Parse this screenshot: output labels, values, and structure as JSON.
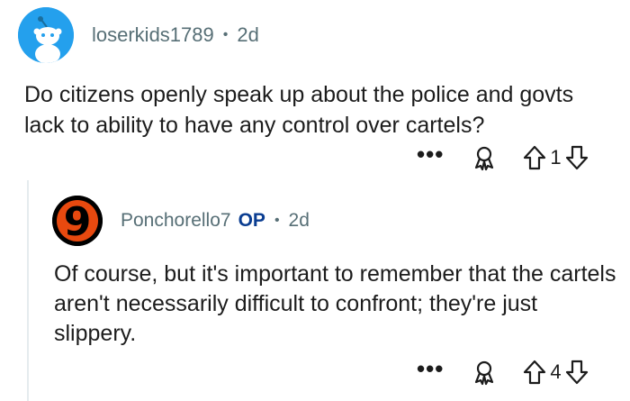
{
  "comment": {
    "author": "loserkids1789",
    "separator": "•",
    "age": "2d",
    "text": "Do citizens openly speak up about the police and govts lack to ability to have any control over cartels?",
    "more_label": "•••",
    "vote_count": "1",
    "avatar_icon": "snoo-avatar-icon",
    "avatar_color": "#24a0ed"
  },
  "reply": {
    "author": "Ponchorello7",
    "badge": "OP",
    "separator": "•",
    "age": "2d",
    "text": "Of course, but it's important to remember that the cartels aren't necessarily difficult to confront; they're just slippery.",
    "more_label": "•••",
    "vote_count": "4",
    "avatar_glyph": "9",
    "avatar_color": "#000000",
    "avatar_accent": "#e8490f"
  },
  "colors": {
    "meta_text": "#576f76",
    "body_text": "#1c1c1c",
    "op_badge": "#0a3d91",
    "thread_line": "#e5ebee"
  }
}
